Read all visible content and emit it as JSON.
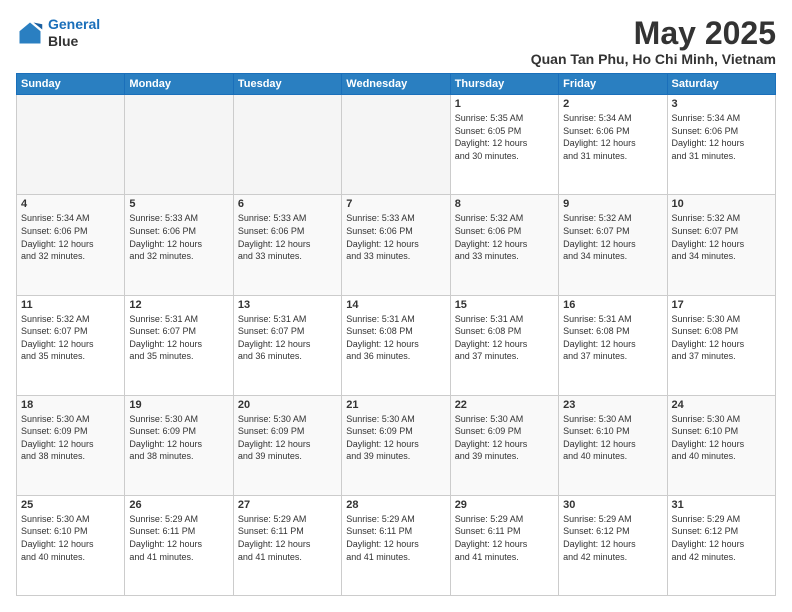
{
  "header": {
    "logo_line1": "General",
    "logo_line2": "Blue",
    "title": "May 2025",
    "subtitle": "Quan Tan Phu, Ho Chi Minh, Vietnam"
  },
  "weekdays": [
    "Sunday",
    "Monday",
    "Tuesday",
    "Wednesday",
    "Thursday",
    "Friday",
    "Saturday"
  ],
  "weeks": [
    [
      {
        "day": "",
        "info": ""
      },
      {
        "day": "",
        "info": ""
      },
      {
        "day": "",
        "info": ""
      },
      {
        "day": "",
        "info": ""
      },
      {
        "day": "1",
        "info": "Sunrise: 5:35 AM\nSunset: 6:05 PM\nDaylight: 12 hours\nand 30 minutes."
      },
      {
        "day": "2",
        "info": "Sunrise: 5:34 AM\nSunset: 6:06 PM\nDaylight: 12 hours\nand 31 minutes."
      },
      {
        "day": "3",
        "info": "Sunrise: 5:34 AM\nSunset: 6:06 PM\nDaylight: 12 hours\nand 31 minutes."
      }
    ],
    [
      {
        "day": "4",
        "info": "Sunrise: 5:34 AM\nSunset: 6:06 PM\nDaylight: 12 hours\nand 32 minutes."
      },
      {
        "day": "5",
        "info": "Sunrise: 5:33 AM\nSunset: 6:06 PM\nDaylight: 12 hours\nand 32 minutes."
      },
      {
        "day": "6",
        "info": "Sunrise: 5:33 AM\nSunset: 6:06 PM\nDaylight: 12 hours\nand 33 minutes."
      },
      {
        "day": "7",
        "info": "Sunrise: 5:33 AM\nSunset: 6:06 PM\nDaylight: 12 hours\nand 33 minutes."
      },
      {
        "day": "8",
        "info": "Sunrise: 5:32 AM\nSunset: 6:06 PM\nDaylight: 12 hours\nand 33 minutes."
      },
      {
        "day": "9",
        "info": "Sunrise: 5:32 AM\nSunset: 6:07 PM\nDaylight: 12 hours\nand 34 minutes."
      },
      {
        "day": "10",
        "info": "Sunrise: 5:32 AM\nSunset: 6:07 PM\nDaylight: 12 hours\nand 34 minutes."
      }
    ],
    [
      {
        "day": "11",
        "info": "Sunrise: 5:32 AM\nSunset: 6:07 PM\nDaylight: 12 hours\nand 35 minutes."
      },
      {
        "day": "12",
        "info": "Sunrise: 5:31 AM\nSunset: 6:07 PM\nDaylight: 12 hours\nand 35 minutes."
      },
      {
        "day": "13",
        "info": "Sunrise: 5:31 AM\nSunset: 6:07 PM\nDaylight: 12 hours\nand 36 minutes."
      },
      {
        "day": "14",
        "info": "Sunrise: 5:31 AM\nSunset: 6:08 PM\nDaylight: 12 hours\nand 36 minutes."
      },
      {
        "day": "15",
        "info": "Sunrise: 5:31 AM\nSunset: 6:08 PM\nDaylight: 12 hours\nand 37 minutes."
      },
      {
        "day": "16",
        "info": "Sunrise: 5:31 AM\nSunset: 6:08 PM\nDaylight: 12 hours\nand 37 minutes."
      },
      {
        "day": "17",
        "info": "Sunrise: 5:30 AM\nSunset: 6:08 PM\nDaylight: 12 hours\nand 37 minutes."
      }
    ],
    [
      {
        "day": "18",
        "info": "Sunrise: 5:30 AM\nSunset: 6:09 PM\nDaylight: 12 hours\nand 38 minutes."
      },
      {
        "day": "19",
        "info": "Sunrise: 5:30 AM\nSunset: 6:09 PM\nDaylight: 12 hours\nand 38 minutes."
      },
      {
        "day": "20",
        "info": "Sunrise: 5:30 AM\nSunset: 6:09 PM\nDaylight: 12 hours\nand 39 minutes."
      },
      {
        "day": "21",
        "info": "Sunrise: 5:30 AM\nSunset: 6:09 PM\nDaylight: 12 hours\nand 39 minutes."
      },
      {
        "day": "22",
        "info": "Sunrise: 5:30 AM\nSunset: 6:09 PM\nDaylight: 12 hours\nand 39 minutes."
      },
      {
        "day": "23",
        "info": "Sunrise: 5:30 AM\nSunset: 6:10 PM\nDaylight: 12 hours\nand 40 minutes."
      },
      {
        "day": "24",
        "info": "Sunrise: 5:30 AM\nSunset: 6:10 PM\nDaylight: 12 hours\nand 40 minutes."
      }
    ],
    [
      {
        "day": "25",
        "info": "Sunrise: 5:30 AM\nSunset: 6:10 PM\nDaylight: 12 hours\nand 40 minutes."
      },
      {
        "day": "26",
        "info": "Sunrise: 5:29 AM\nSunset: 6:11 PM\nDaylight: 12 hours\nand 41 minutes."
      },
      {
        "day": "27",
        "info": "Sunrise: 5:29 AM\nSunset: 6:11 PM\nDaylight: 12 hours\nand 41 minutes."
      },
      {
        "day": "28",
        "info": "Sunrise: 5:29 AM\nSunset: 6:11 PM\nDaylight: 12 hours\nand 41 minutes."
      },
      {
        "day": "29",
        "info": "Sunrise: 5:29 AM\nSunset: 6:11 PM\nDaylight: 12 hours\nand 41 minutes."
      },
      {
        "day": "30",
        "info": "Sunrise: 5:29 AM\nSunset: 6:12 PM\nDaylight: 12 hours\nand 42 minutes."
      },
      {
        "day": "31",
        "info": "Sunrise: 5:29 AM\nSunset: 6:12 PM\nDaylight: 12 hours\nand 42 minutes."
      }
    ]
  ]
}
